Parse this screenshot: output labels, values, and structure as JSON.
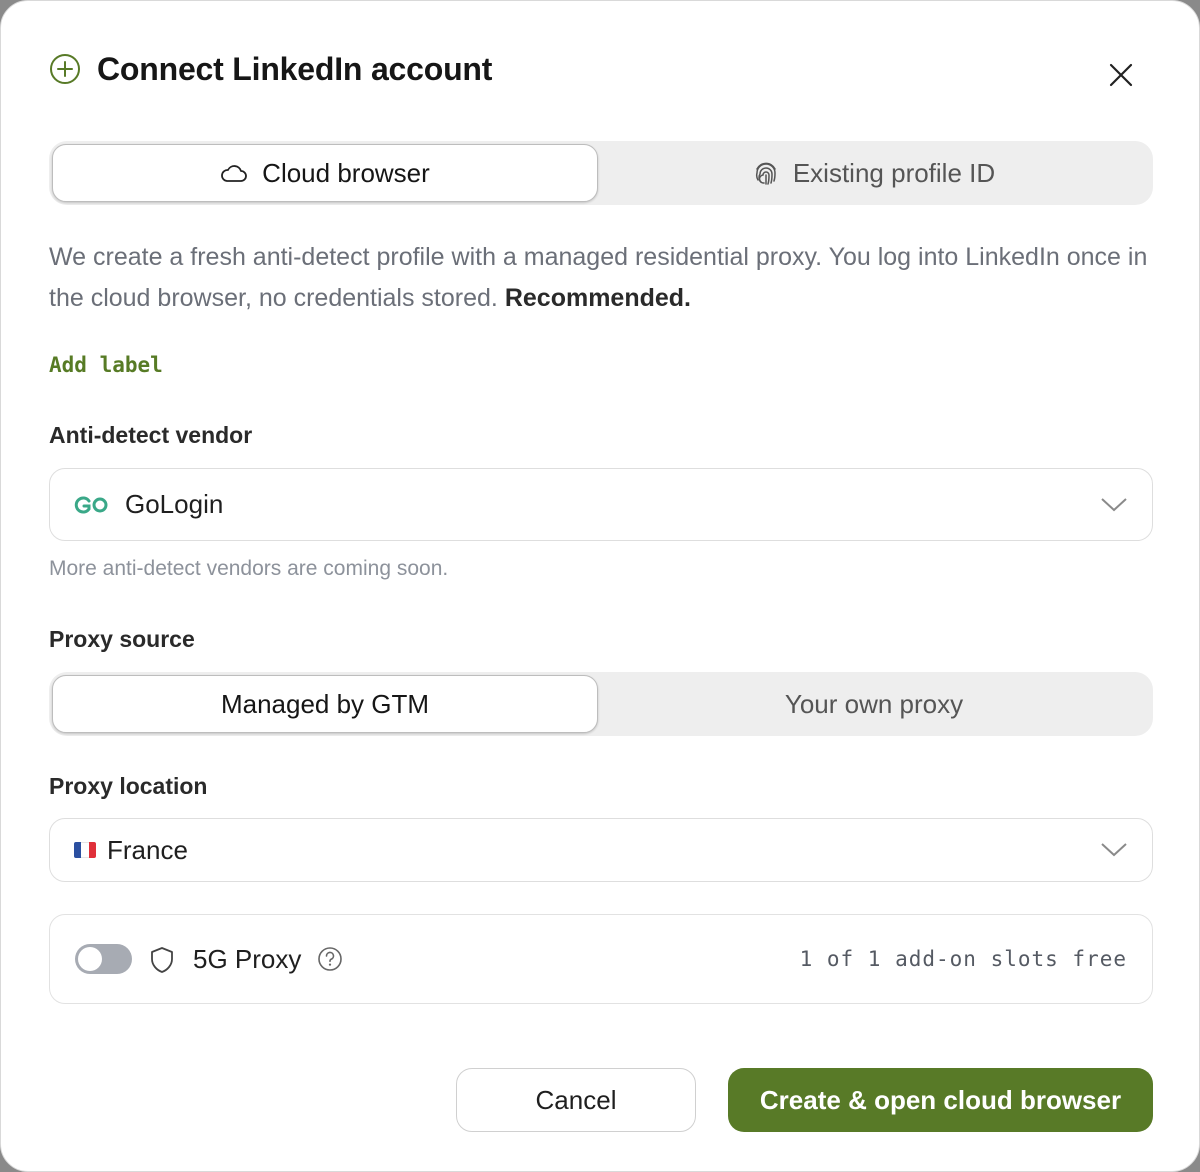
{
  "dialog": {
    "title": "Connect LinkedIn account",
    "icon": "plus-circle-icon"
  },
  "mode_tabs": [
    {
      "label": "Cloud browser",
      "icon": "cloud-icon",
      "active": true
    },
    {
      "label": "Existing profile ID",
      "icon": "fingerprint-icon",
      "active": false
    }
  ],
  "description": {
    "text": "We create a fresh anti-detect profile with a managed residential proxy. You log into LinkedIn once in the cloud browser, no credentials stored.",
    "emphasis": "Recommended."
  },
  "add_label": "Add label",
  "vendor": {
    "label": "Anti-detect vendor",
    "selected": "GoLogin",
    "icon": "gologin-logo",
    "hint": "More anti-detect vendors are coming soon."
  },
  "proxy_source": {
    "label": "Proxy source",
    "options": [
      {
        "label": "Managed by GTM",
        "active": true
      },
      {
        "label": "Your own proxy",
        "active": false
      }
    ]
  },
  "proxy_location": {
    "label": "Proxy location",
    "selected": "France",
    "flag": "france-flag-icon"
  },
  "addon": {
    "name": "5G Proxy",
    "enabled": false,
    "slots_text": "1 of 1 add-on slots free"
  },
  "actions": {
    "cancel": "Cancel",
    "submit": "Create & open cloud browser"
  },
  "colors": {
    "accent": "#587a27",
    "accent_text": "#577b25",
    "gologin": "#3aa888",
    "toggle_off": "#a7abb3"
  }
}
